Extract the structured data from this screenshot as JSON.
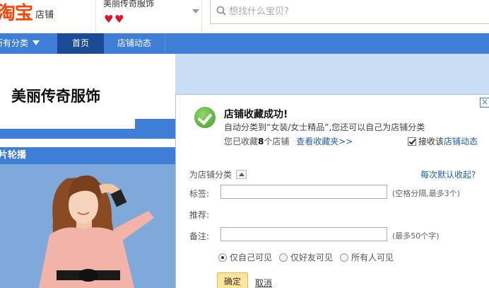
{
  "header": {
    "logo_text": "淘宝",
    "logo_suffix": "店铺",
    "shop_name": "美丽传奇服饰",
    "rating_hearts": 2,
    "search_placeholder": "想找什么宝贝?"
  },
  "nav": {
    "category_label": "所有分类",
    "home_label": "首页",
    "dynamics_label": "店铺动态"
  },
  "banner": {
    "shop_title": "美丽传奇服饰"
  },
  "carousel": {
    "heading": "片轮播"
  },
  "dialog": {
    "title": "店铺收藏成功!",
    "subtitle": "自动分类到“女装/女士精品”,您还可以自己为店铺分类",
    "count_prefix": "您已收藏",
    "count": "8",
    "count_suffix": "个店铺",
    "view_link": "查看收藏夹>>",
    "follow_prefix": "接收该",
    "follow_accent": "店铺动态",
    "follow_checked": true,
    "classify_label": "为店铺分类",
    "default_collapse": "每次默认收起?",
    "tags_label": "标签:",
    "tags_value": "",
    "tags_hint": "(空格分隔,最多3个)",
    "recommend_label": "推荐:",
    "note_label": "备注:",
    "note_value": "",
    "note_hint": "(最多50个字)",
    "visibility_options": [
      "仅自己可见",
      "仅好友可见",
      "所有人可见"
    ],
    "visibility_selected": "仅自己可见",
    "confirm_label": "确定",
    "cancel_label": "取消",
    "close_glyph": "×"
  },
  "colors": {
    "brand_orange": "#ff4400",
    "nav_blue": "#3f7ed6",
    "nav_active": "#1b4c93",
    "link_blue": "#1e5fb5",
    "success_green": "#3f9f22",
    "banner_bg": "#c9def4"
  }
}
